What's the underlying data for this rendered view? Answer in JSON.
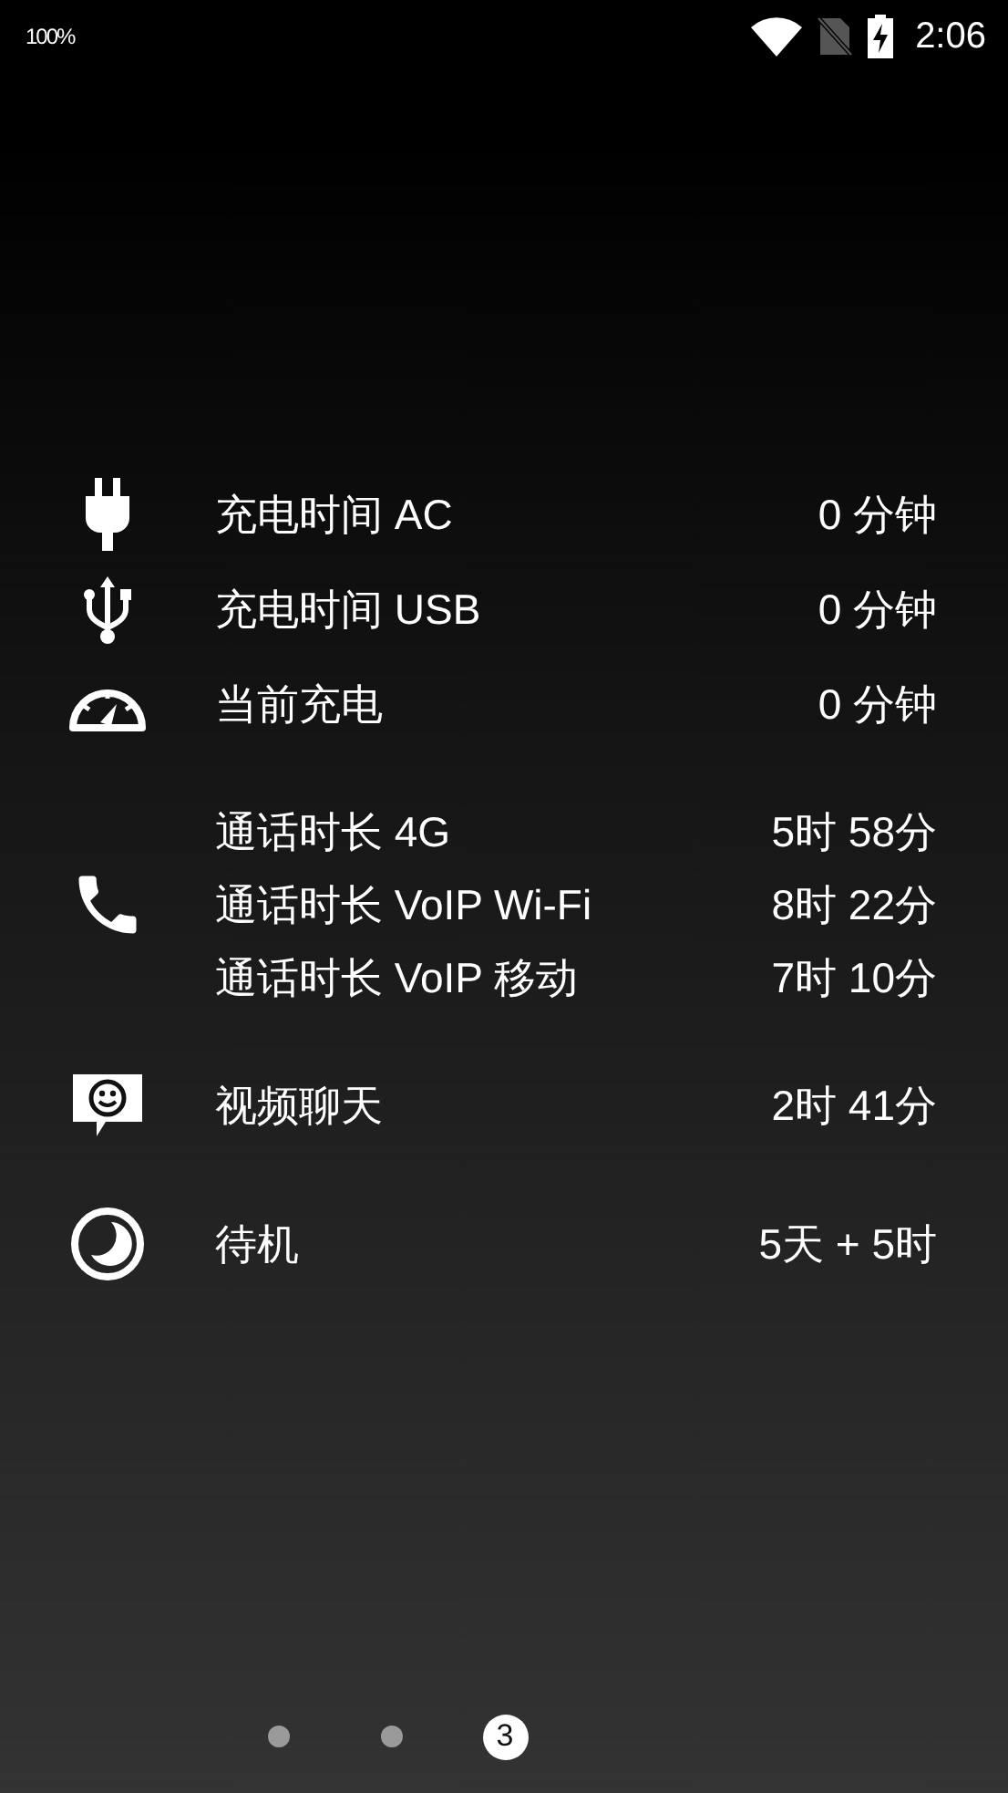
{
  "status_bar": {
    "battery_text": "100%",
    "time": "2:06"
  },
  "groups": [
    {
      "kind": "plug",
      "rows": [
        {
          "label": "充电时间 AC",
          "value": "0 分钟"
        }
      ]
    },
    {
      "kind": "usb",
      "rows": [
        {
          "label": "充电时间 USB",
          "value": "0 分钟"
        }
      ]
    },
    {
      "kind": "gauge",
      "rows": [
        {
          "label": "当前充电",
          "value": "0 分钟"
        }
      ]
    },
    {
      "kind": "phone",
      "rows": [
        {
          "label": "通话时长 4G",
          "value": "5时 58分"
        },
        {
          "label": "通话时长 VoIP Wi-Fi",
          "value": "8时 22分"
        },
        {
          "label": "通话时长 VoIP 移动",
          "value": "7时 10分"
        }
      ]
    },
    {
      "kind": "chat",
      "rows": [
        {
          "label": "视频聊天",
          "value": "2时 41分"
        }
      ]
    },
    {
      "kind": "moon",
      "rows": [
        {
          "label": "待机",
          "value": "5天 + 5时"
        }
      ]
    }
  ],
  "pager": [
    {
      "selected": false
    },
    {
      "selected": false
    },
    {
      "selected": true,
      "label": "3"
    }
  ]
}
